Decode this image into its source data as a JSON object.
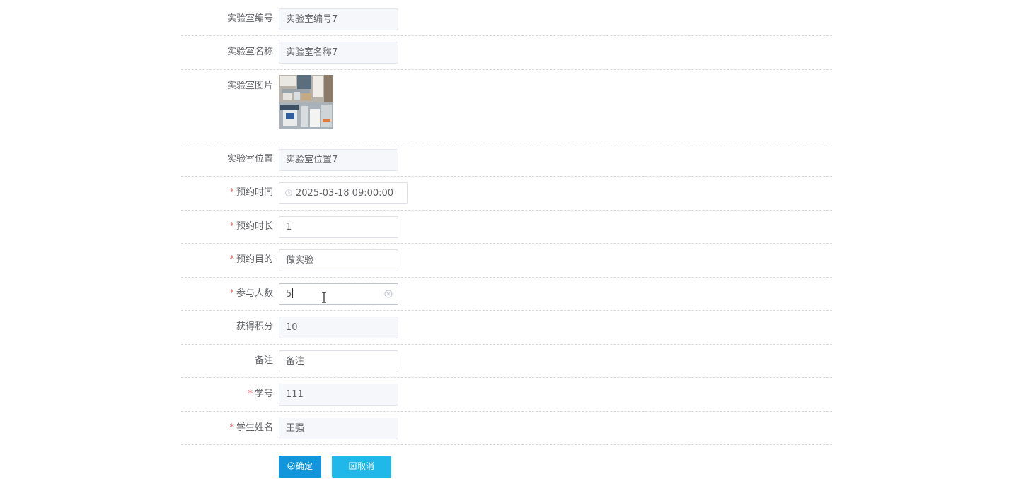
{
  "form": {
    "fields": {
      "lab_code": {
        "label": "实验室编号",
        "value": "实验室编号7"
      },
      "lab_name": {
        "label": "实验室名称",
        "value": "实验室名称7"
      },
      "lab_image": {
        "label": "实验室图片"
      },
      "lab_location": {
        "label": "实验室位置",
        "value": "实验室位置7"
      },
      "reserve_time": {
        "required_mark": "*",
        "label": "预约时间",
        "value": "2025-03-18 09:00:00"
      },
      "reserve_duration": {
        "required_mark": "*",
        "label": "预约时长",
        "value": "1"
      },
      "reserve_purpose": {
        "required_mark": "*",
        "label": "预约目的",
        "value": "做实验"
      },
      "participants": {
        "required_mark": "*",
        "label": "参与人数",
        "value": "5"
      },
      "points": {
        "label": "获得积分",
        "value": "10"
      },
      "remark": {
        "label": "备注",
        "value": "备注"
      },
      "student_id": {
        "required_mark": "*",
        "label": "学号",
        "value": "111"
      },
      "student_name": {
        "required_mark": "*",
        "label": "学生姓名",
        "value": "王强"
      }
    },
    "buttons": {
      "confirm": "确定",
      "cancel": "取消"
    }
  },
  "colors": {
    "primary_button": "#1296db",
    "cancel_button": "#1fb8e8",
    "required": "#f56c6c"
  },
  "icons": [
    "clock-icon",
    "clear-icon",
    "check-circle-icon",
    "close-square-icon",
    "text-cursor-icon"
  ]
}
